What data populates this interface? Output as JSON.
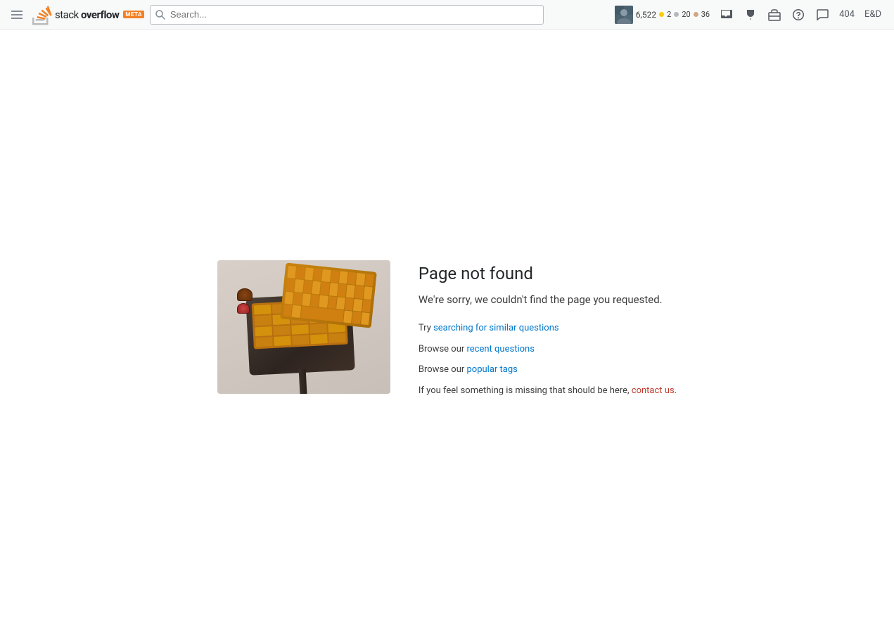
{
  "header": {
    "hamburger_label": "Menu",
    "logo_text": "stack overflow",
    "logo_bold": "overflow",
    "meta_badge": "META",
    "search_placeholder": "Search...",
    "user": {
      "reputation": "6,522",
      "gold_count": "2",
      "silver_count": "20",
      "bronze_count": "36"
    },
    "nav_icons": {
      "inbox": "Inbox",
      "achievements": "Achievements",
      "jobs": "Jobs",
      "help": "Help Center",
      "chat": "Chat"
    },
    "link_404": "404",
    "link_end": "E&D"
  },
  "error_page": {
    "title": "Page not found",
    "subtitle": "We're sorry, we couldn't find the page you requested.",
    "try_text": "Try ",
    "searching_link": "searching for similar questions",
    "browse_recent_text": "Browse our ",
    "recent_link": "recent questions",
    "browse_popular_text": "Browse our ",
    "popular_link": "popular tags",
    "missing_text": "If you feel something is missing that should be here, ",
    "contact_link": "contact us",
    "missing_end": "."
  }
}
